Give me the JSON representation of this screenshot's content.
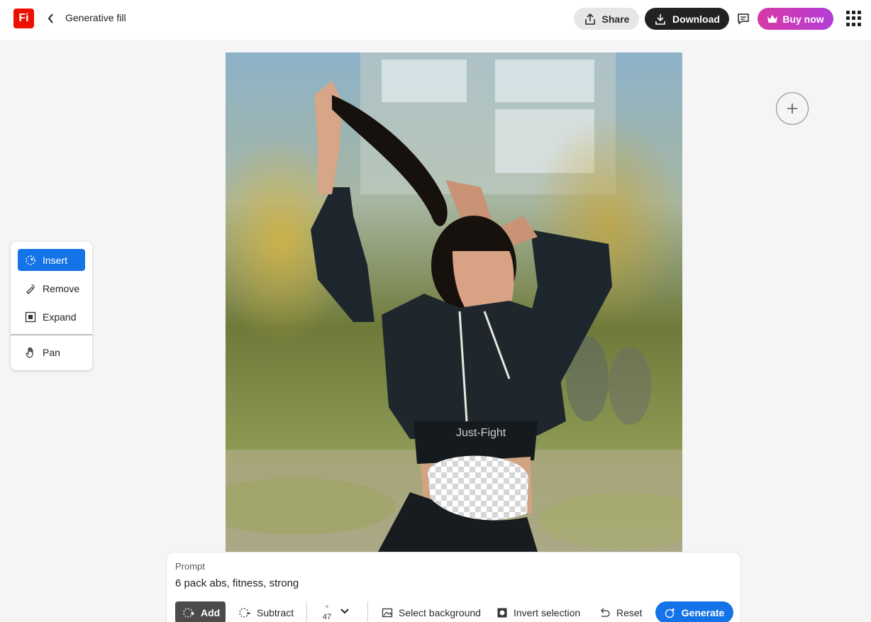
{
  "header": {
    "logo_text": "Fi",
    "title": "Generative fill",
    "share_label": "Share",
    "download_label": "Download",
    "buy_label": "Buy now",
    "icons": {
      "back": "chevron-left-icon",
      "share": "share-icon",
      "download": "download-icon",
      "comment": "comment-icon",
      "crown": "crown-icon",
      "apps": "apps-grid-icon"
    }
  },
  "canvas": {
    "shirt_text": "Just-Fight",
    "zoom_icon": "plus-icon"
  },
  "tools": {
    "items": [
      {
        "label": "Insert",
        "icon": "insert-icon",
        "active": true
      },
      {
        "label": "Remove",
        "icon": "remove-icon",
        "active": false
      },
      {
        "label": "Expand",
        "icon": "expand-icon",
        "active": false
      },
      {
        "label": "Pan",
        "icon": "hand-icon",
        "active": false
      }
    ]
  },
  "prompt": {
    "label": "Prompt",
    "value": "6 pack abs, fitness, strong",
    "add_label": "Add",
    "subtract_label": "Subtract",
    "brush_size": "47",
    "select_background_label": "Select background",
    "invert_selection_label": "Invert selection",
    "reset_label": "Reset",
    "generate_label": "Generate"
  },
  "colors": {
    "brand": "#eb1000",
    "accent": "#1473e6",
    "buy_gradient_start": "#d63aa6",
    "buy_gradient_end": "#b43cd6"
  }
}
